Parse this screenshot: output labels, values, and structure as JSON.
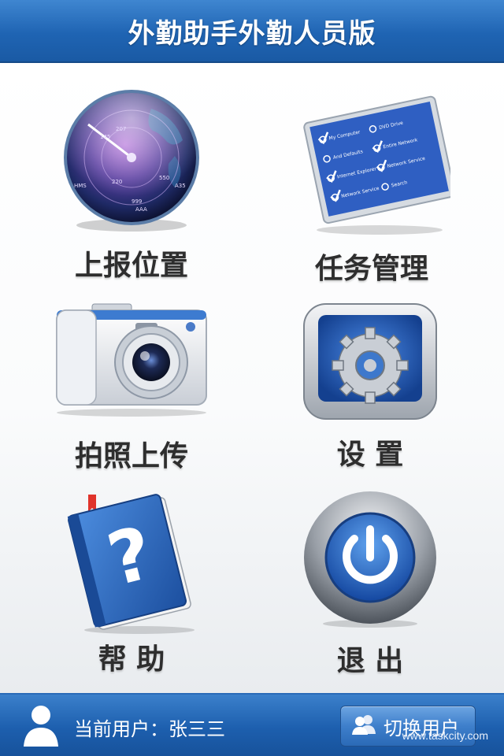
{
  "header": {
    "title": "外勤助手外勤人员版"
  },
  "menu": {
    "report_location": "上报位置",
    "task_management": "任务管理",
    "photo_upload": "拍照上传",
    "settings": "设 置",
    "help": "帮 助",
    "exit": "退 出"
  },
  "radar": {
    "labels": [
      "145",
      "207",
      "HMS",
      "220",
      "550",
      "A35",
      "999",
      "AAA"
    ]
  },
  "checklist": {
    "items": [
      "My Computer",
      "DVD Drive",
      "And Defaults",
      "Entire Network",
      "Internet Explorer",
      "Network Service",
      "Network Service",
      "Search"
    ]
  },
  "footer": {
    "current_user_label": "当前用户：张三三",
    "switch_user_label": "切换用户",
    "watermark": "www.taskcity.com"
  },
  "colors": {
    "header_blue": "#1f64b3",
    "footer_blue": "#1d5fae",
    "label_text": "#2e2e2e"
  }
}
